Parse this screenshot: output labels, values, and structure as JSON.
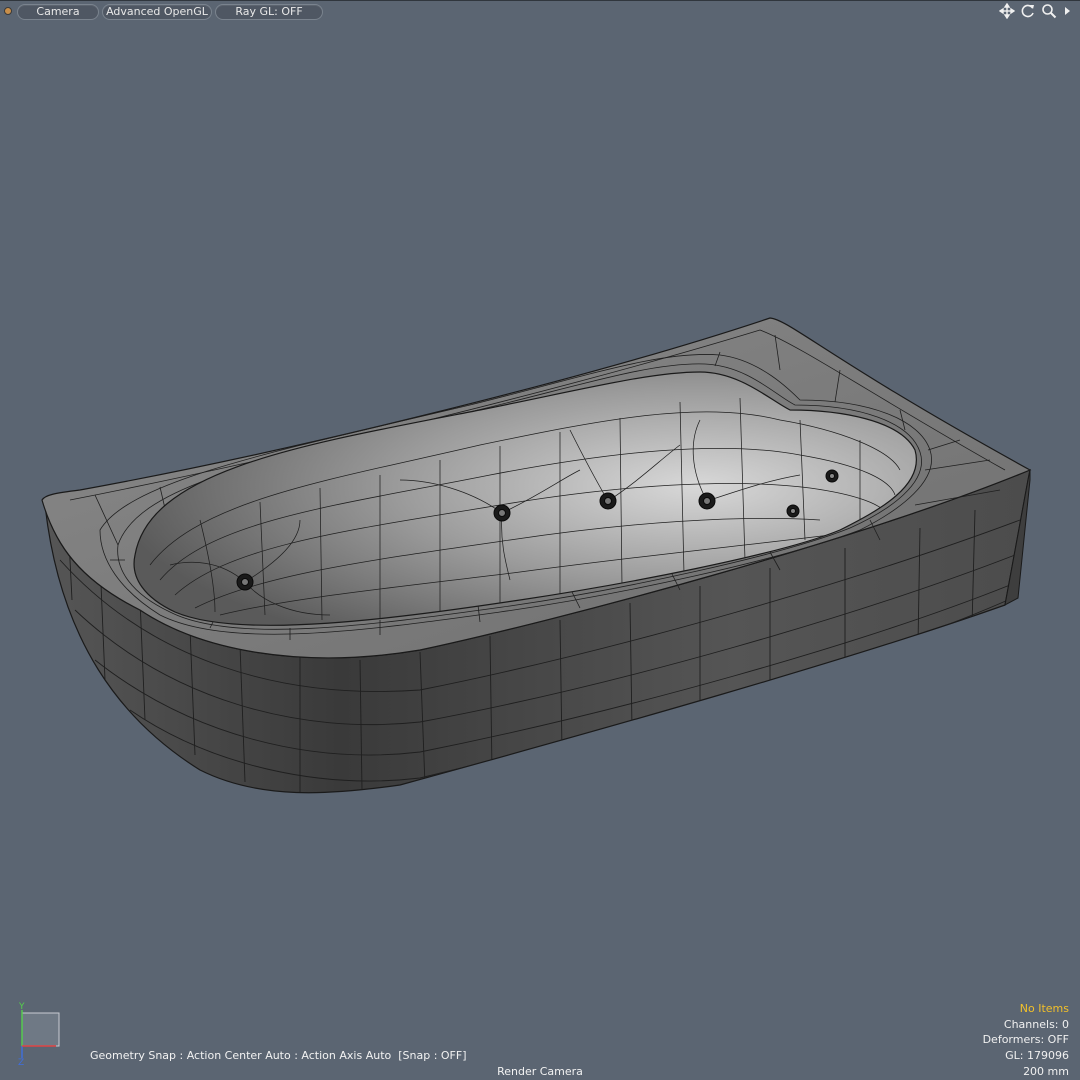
{
  "toolbar": {
    "camera_label": "Camera",
    "shading_label": "Advanced OpenGL",
    "raygl_label": "Ray GL: OFF",
    "nav_icons": [
      "move-view-icon",
      "rotate-view-icon",
      "zoom-view-icon",
      "more-arrow-icon"
    ]
  },
  "viewport": {
    "background": "#5b6572",
    "model_color": "#4a4a4a",
    "wire_color": "#1a1a1a",
    "snap_status": "Geometry Snap : Action Center Auto : Action Axis Auto  [Snap : OFF]",
    "camera_name": "Render Camera",
    "axis_y_label": "Y",
    "axis_z_label": "Z"
  },
  "stats": {
    "items": "No Items",
    "items_color": "#f2c02a",
    "channels": "Channels: 0",
    "deformers": "Deformers: OFF",
    "gl": "GL: 179096",
    "scale": "200 mm"
  }
}
